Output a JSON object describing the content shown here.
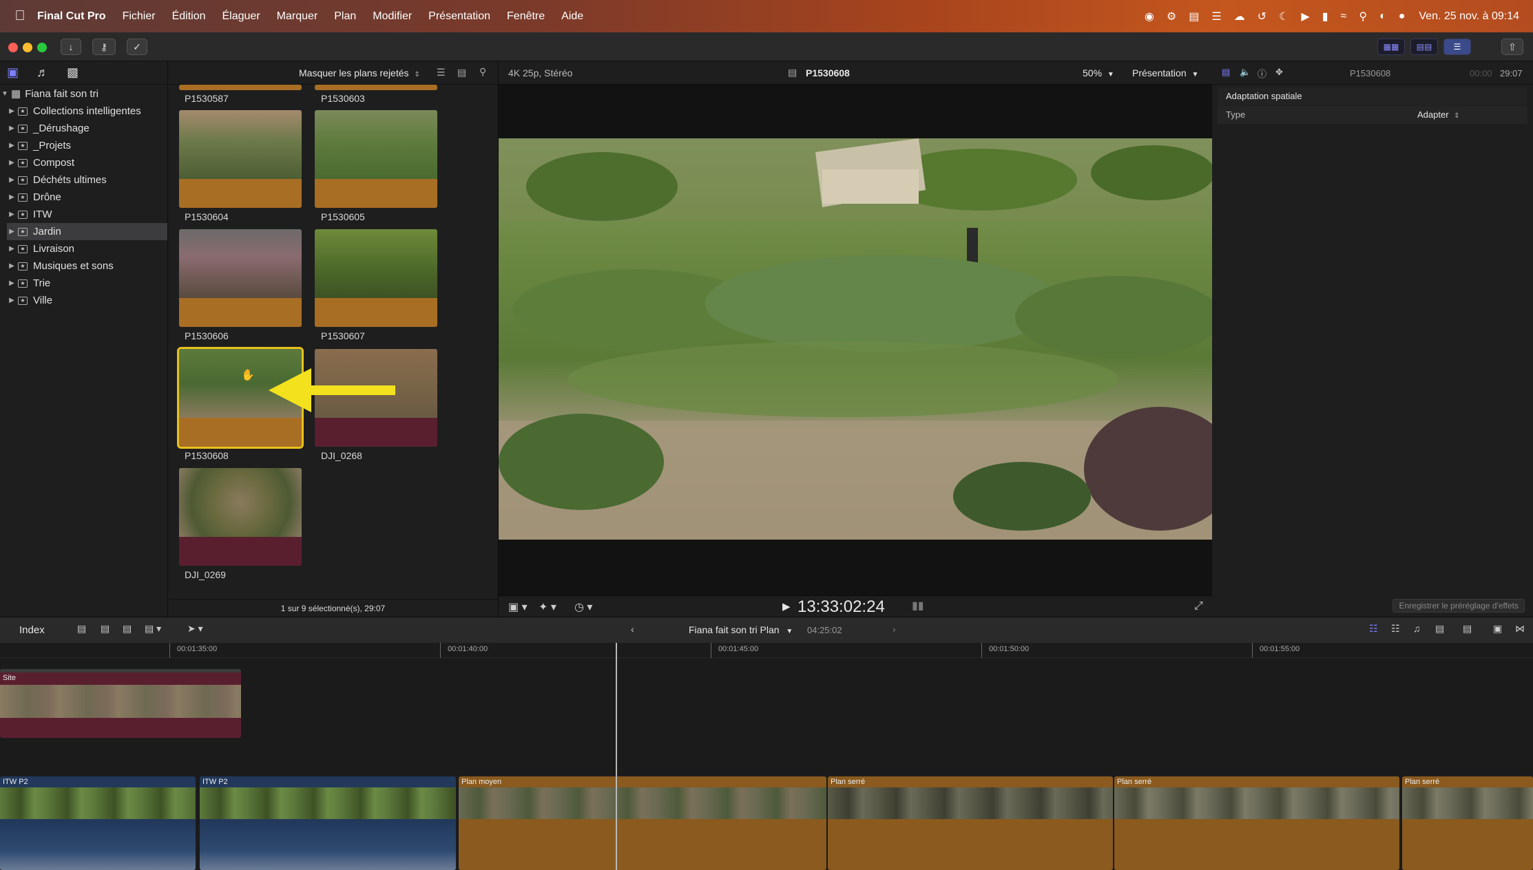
{
  "menubar": {
    "app": "Final Cut Pro",
    "items": [
      "Fichier",
      "Édition",
      "Élaguer",
      "Marquer",
      "Plan",
      "Modifier",
      "Présentation",
      "Fenêtre",
      "Aide"
    ],
    "clock": "Ven. 25 nov. à 09:14"
  },
  "libraries": {
    "library": "Fiana fait son tri",
    "items": [
      {
        "label": "Collections intelligentes",
        "selected": false
      },
      {
        "label": "_Dérushage",
        "selected": false
      },
      {
        "label": "_Projets",
        "selected": false
      },
      {
        "label": "Compost",
        "selected": false
      },
      {
        "label": "Déchéts ultimes",
        "selected": false
      },
      {
        "label": "Drône",
        "selected": false
      },
      {
        "label": "ITW",
        "selected": false
      },
      {
        "label": "Jardin",
        "selected": true
      },
      {
        "label": "Livraison",
        "selected": false
      },
      {
        "label": "Musiques et sons",
        "selected": false
      },
      {
        "label": "Trie",
        "selected": false
      },
      {
        "label": "Ville",
        "selected": false
      }
    ]
  },
  "browser": {
    "filter": "Masquer les plans rejetés",
    "clips": [
      "P1530587",
      "P1530603",
      "P1530604",
      "P1530605",
      "P1530606",
      "P1530607",
      "P1530608",
      "DJI_0268",
      "DJI_0269"
    ],
    "status": "1 sur 9 sélectionné(s), 29:07"
  },
  "viewer": {
    "format": "4K 25p, Stéréo",
    "clip_name": "P1530608",
    "zoom": "50%",
    "presentation": "Présentation",
    "timecode": "13:33:02:24"
  },
  "inspector": {
    "clip_name": "P1530608",
    "duration_prefix": "00:00",
    "duration": "29:07",
    "section": "Adaptation spatiale",
    "type_label": "Type",
    "type_value": "Adapter",
    "save_preset": "Enregistrer le préréglage d'effets"
  },
  "timeline": {
    "index": "Index",
    "project": "Fiana fait son tri Plan",
    "duration": "04:25:02",
    "ruler": [
      "00:01:35:00",
      "00:01:40:00",
      "00:01:45:00",
      "00:01:50:00",
      "00:01:55:00"
    ],
    "clips": {
      "site": "Site",
      "itw1": "ITW P2",
      "itw2": "ITW P2",
      "moyen": "Plan moyen",
      "serre1": "Plan serré",
      "serre2": "Plan serré",
      "serre3": "Plan serré"
    }
  },
  "colors": {
    "accent": "#7e80ff",
    "selection": "#e7c11c",
    "audio_clip": "#a86e24",
    "connected_clip": "#5a1f2f",
    "itw_clip": "#2a3f66"
  }
}
